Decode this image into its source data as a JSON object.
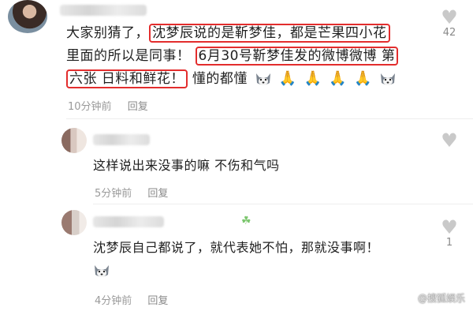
{
  "comments": [
    {
      "line1_plain": "大家别猜了，",
      "line1_hl": "沈梦辰说的是靳梦佳，都是芒果四小花",
      "line2_plain": "里面的所以是同事！",
      "line2_hl": "6月30号靳梦佳发的微博微博 第",
      "line3_hl": "六张 日料和鲜花！",
      "line3_plain": "懂的都懂",
      "time": "10分钟前",
      "reply": "回复",
      "likes": "42"
    },
    {
      "text": "这样说出来没事的嘛 不伤和气吗",
      "time": "5分钟前",
      "reply": "回复"
    },
    {
      "text": "沈梦辰自己都说了，就代表她不怕，那就没事啊！",
      "time": "4分钟前",
      "reply": "回复",
      "likes": "1"
    }
  ],
  "watermark": "@搜狐娱乐"
}
